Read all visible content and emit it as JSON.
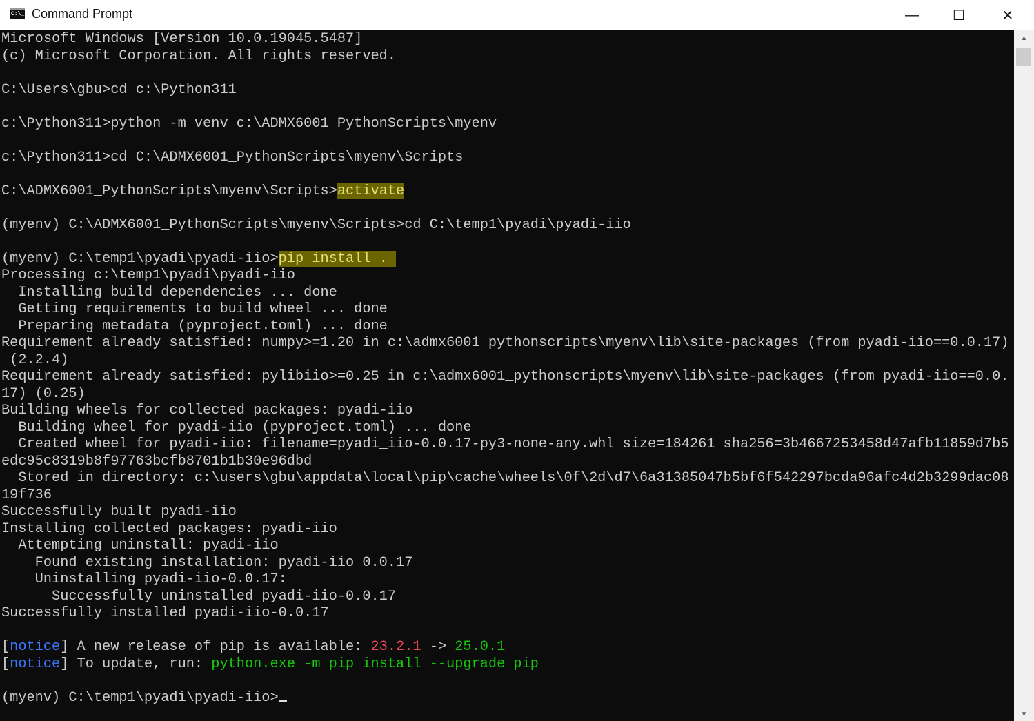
{
  "window": {
    "title": "Command Prompt",
    "icon": "cmd-icon",
    "icon_text": "C:\\_",
    "minimize": "—",
    "maximize": "☐",
    "close": "✕"
  },
  "console": {
    "lines": [
      [
        {
          "t": "Microsoft Windows [Version 10.0.19045.5487]"
        }
      ],
      [
        {
          "t": "(c) Microsoft Corporation. All rights reserved."
        }
      ],
      [],
      [
        {
          "t": "C:\\Users\\gbu>cd c:\\Python311"
        }
      ],
      [],
      [
        {
          "t": "c:\\Python311>python -m venv c:\\ADMX6001_PythonScripts\\myenv"
        }
      ],
      [],
      [
        {
          "t": "c:\\Python311>cd C:\\ADMX6001_PythonScripts\\myenv\\Scripts"
        }
      ],
      [],
      [
        {
          "t": "C:\\ADMX6001_PythonScripts\\myenv\\Scripts>"
        },
        {
          "t": "activate",
          "c": "hl"
        }
      ],
      [],
      [
        {
          "t": "(myenv) C:\\ADMX6001_PythonScripts\\myenv\\Scripts>cd C:\\temp1\\pyadi\\pyadi-iio"
        }
      ],
      [],
      [
        {
          "t": "(myenv) C:\\temp1\\pyadi\\pyadi-iio>"
        },
        {
          "t": "pip install . ",
          "c": "hl"
        }
      ],
      [
        {
          "t": "Processing c:\\temp1\\pyadi\\pyadi-iio"
        }
      ],
      [
        {
          "t": "  Installing build dependencies ... done"
        }
      ],
      [
        {
          "t": "  Getting requirements to build wheel ... done"
        }
      ],
      [
        {
          "t": "  Preparing metadata (pyproject.toml) ... done"
        }
      ],
      [
        {
          "t": "Requirement already satisfied: numpy>=1.20 in c:\\admx6001_pythonscripts\\myenv\\lib\\site-packages (from pyadi-iio==0.0.17)"
        }
      ],
      [
        {
          "t": " (2.2.4)"
        }
      ],
      [
        {
          "t": "Requirement already satisfied: pylibiio>=0.25 in c:\\admx6001_pythonscripts\\myenv\\lib\\site-packages (from pyadi-iio==0.0."
        }
      ],
      [
        {
          "t": "17) (0.25)"
        }
      ],
      [
        {
          "t": "Building wheels for collected packages: pyadi-iio"
        }
      ],
      [
        {
          "t": "  Building wheel for pyadi-iio (pyproject.toml) ... done"
        }
      ],
      [
        {
          "t": "  Created wheel for pyadi-iio: filename=pyadi_iio-0.0.17-py3-none-any.whl size=184261 sha256=3b4667253458d47afb11859d7b5"
        }
      ],
      [
        {
          "t": "edc95c8319b8f97763bcfb8701b1b30e96dbd"
        }
      ],
      [
        {
          "t": "  Stored in directory: c:\\users\\gbu\\appdata\\local\\pip\\cache\\wheels\\0f\\2d\\d7\\6a31385047b5bf6f542297bcda96afc4d2b3299dac08"
        }
      ],
      [
        {
          "t": "19f736"
        }
      ],
      [
        {
          "t": "Successfully built pyadi-iio"
        }
      ],
      [
        {
          "t": "Installing collected packages: pyadi-iio"
        }
      ],
      [
        {
          "t": "  Attempting uninstall: pyadi-iio"
        }
      ],
      [
        {
          "t": "    Found existing installation: pyadi-iio 0.0.17"
        }
      ],
      [
        {
          "t": "    Uninstalling pyadi-iio-0.0.17:"
        }
      ],
      [
        {
          "t": "      Successfully uninstalled pyadi-iio-0.0.17"
        }
      ],
      [
        {
          "t": "Successfully installed pyadi-iio-0.0.17"
        }
      ],
      [],
      [
        {
          "t": "["
        },
        {
          "t": "notice",
          "c": "blue"
        },
        {
          "t": "] A new release of pip is available: "
        },
        {
          "t": "23.2.1",
          "c": "red"
        },
        {
          "t": " -> "
        },
        {
          "t": "25.0.1",
          "c": "green"
        }
      ],
      [
        {
          "t": "["
        },
        {
          "t": "notice",
          "c": "blue"
        },
        {
          "t": "] To update, run: "
        },
        {
          "t": "python.exe -m pip install --upgrade pip",
          "c": "green"
        }
      ],
      [],
      [
        {
          "t": "(myenv) C:\\temp1\\pyadi\\pyadi-iio>"
        }
      ]
    ]
  },
  "scrollbar": {
    "up": "▲",
    "down": "▼"
  }
}
